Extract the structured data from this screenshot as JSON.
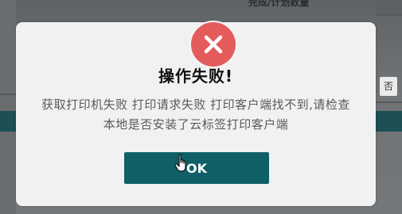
{
  "background": {
    "header_label": "完成/计划数量",
    "right_chip_label": "否"
  },
  "dialog": {
    "icon": "close-icon",
    "icon_color": "#e45b5b",
    "title": "操作失败!",
    "message": "获取打印机失败 打印请求失败 打印客户端找不到,请检查本地是否安装了云标签打印客户端",
    "ok_label": "OK",
    "ok_color": "#0f5f68"
  }
}
